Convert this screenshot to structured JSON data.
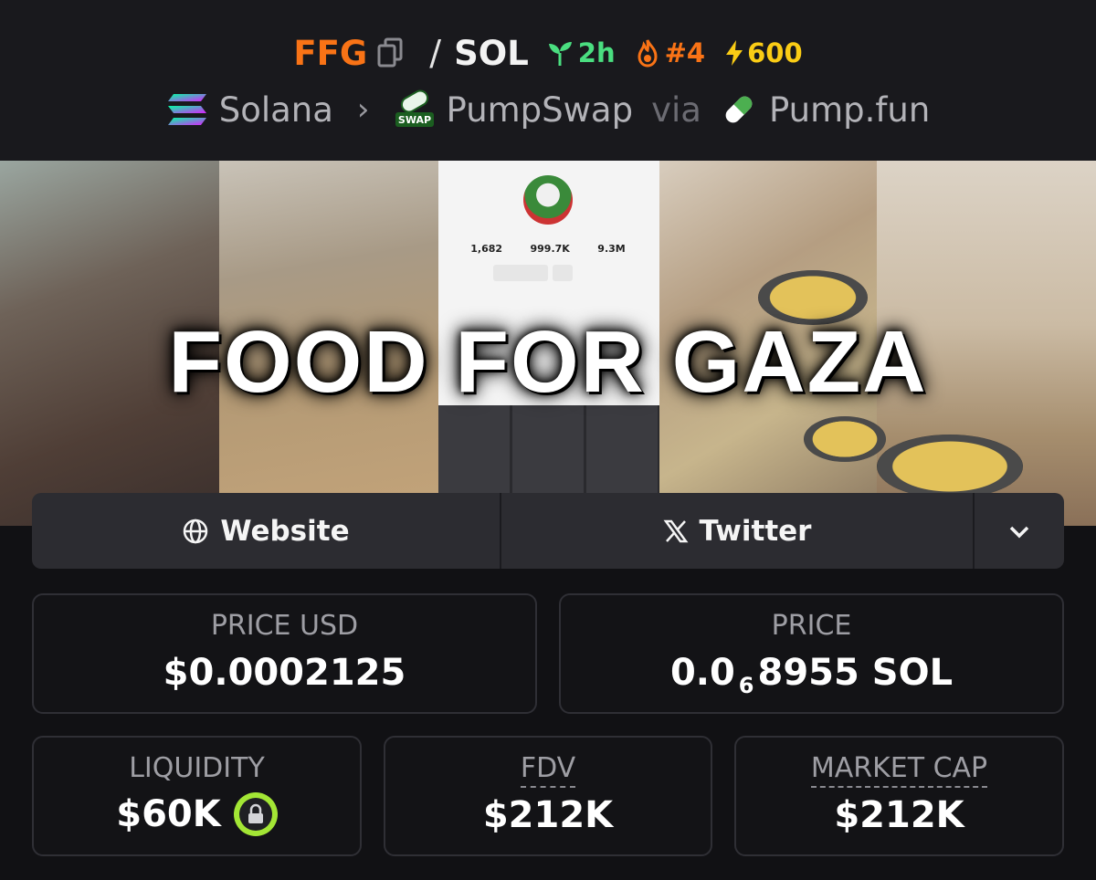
{
  "header": {
    "symbol": "FFG",
    "slash": "/",
    "quote": "SOL",
    "age": "2h",
    "rank": "#4",
    "boosts": "600",
    "chain": "Solana",
    "dex": "PumpSwap",
    "dex_badge": "SWAP",
    "via": "via",
    "launchpad": "Pump.fun"
  },
  "banner": {
    "title": "FOOD FOR GAZA",
    "phone_stats": [
      "1,682",
      "999.7K",
      "9.3M"
    ]
  },
  "links": {
    "website": "Website",
    "twitter": "Twitter"
  },
  "stats": {
    "price_usd_label": "PRICE USD",
    "price_usd_value": "$0.0002125",
    "price_label": "PRICE",
    "price_prefix": "0.0",
    "price_zeros": "6",
    "price_suffix": "8955 SOL",
    "liquidity_label": "LIQUIDITY",
    "liquidity_value": "$60K",
    "fdv_label": "FDV",
    "fdv_value": "$212K",
    "mcap_label": "MARKET CAP",
    "mcap_value": "$212K"
  },
  "colors": {
    "symbol": "#f97316",
    "age": "#4ade80",
    "rank": "#f97316",
    "boosts": "#facc15",
    "lock": "#a3e635"
  },
  "icons": [
    "copy-icon",
    "seedling-icon",
    "fire-icon",
    "lightning-icon",
    "solana-icon",
    "pumpswap-icon",
    "pill-icon",
    "globe-icon",
    "x-icon",
    "chevron-down-icon",
    "lock-icon"
  ]
}
